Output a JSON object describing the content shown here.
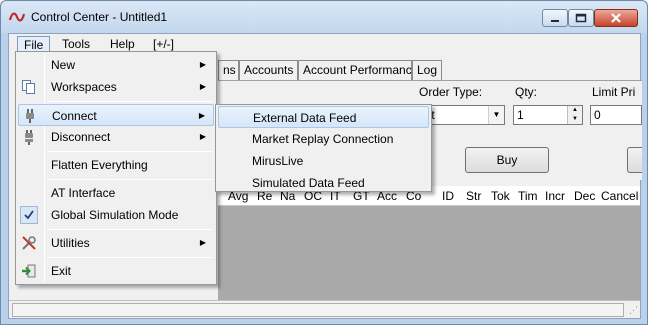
{
  "window": {
    "title": "Control Center - Untitled1"
  },
  "menubar": {
    "items": [
      "File",
      "Tools",
      "Help",
      "[+/-]"
    ]
  },
  "tabs": [
    "ns",
    "Accounts",
    "Account Performance",
    "Log"
  ],
  "order_panel": {
    "order_type_label": "Order Type:",
    "order_type_value": "nit",
    "qty_label": "Qty:",
    "qty_value": "1",
    "limit_price_label": "Limit Pri",
    "limit_price_value": "0",
    "buy_label": "Buy"
  },
  "grid": {
    "columns": [
      "Avg",
      "Re",
      "Na",
      "OC",
      "IT",
      "GT",
      "Acc",
      "Co",
      "ID",
      "Str",
      "Tok",
      "Tim",
      "Incr",
      "Dec",
      "Cancel"
    ]
  },
  "file_menu": {
    "items": [
      {
        "label": "New",
        "icon": "",
        "submenu": true
      },
      {
        "label": "Workspaces",
        "icon": "workspaces-icon",
        "submenu": true
      },
      {
        "label": "Connect",
        "icon": "plug-icon",
        "submenu": true
      },
      {
        "label": "Disconnect",
        "icon": "unplug-icon",
        "submenu": true
      },
      {
        "label": "Flatten Everything",
        "icon": "",
        "submenu": false
      },
      {
        "label": "AT Interface",
        "icon": "",
        "submenu": false
      },
      {
        "label": "Global Simulation Mode",
        "icon": "checkmark-icon",
        "submenu": false
      },
      {
        "label": "Utilities",
        "icon": "tools-icon",
        "submenu": true
      },
      {
        "label": "Exit",
        "icon": "exit-icon",
        "submenu": false
      }
    ]
  },
  "connect_submenu": {
    "items": [
      "External Data Feed",
      "Market Replay Connection",
      "MirusLive",
      "Simulated Data Feed"
    ]
  }
}
